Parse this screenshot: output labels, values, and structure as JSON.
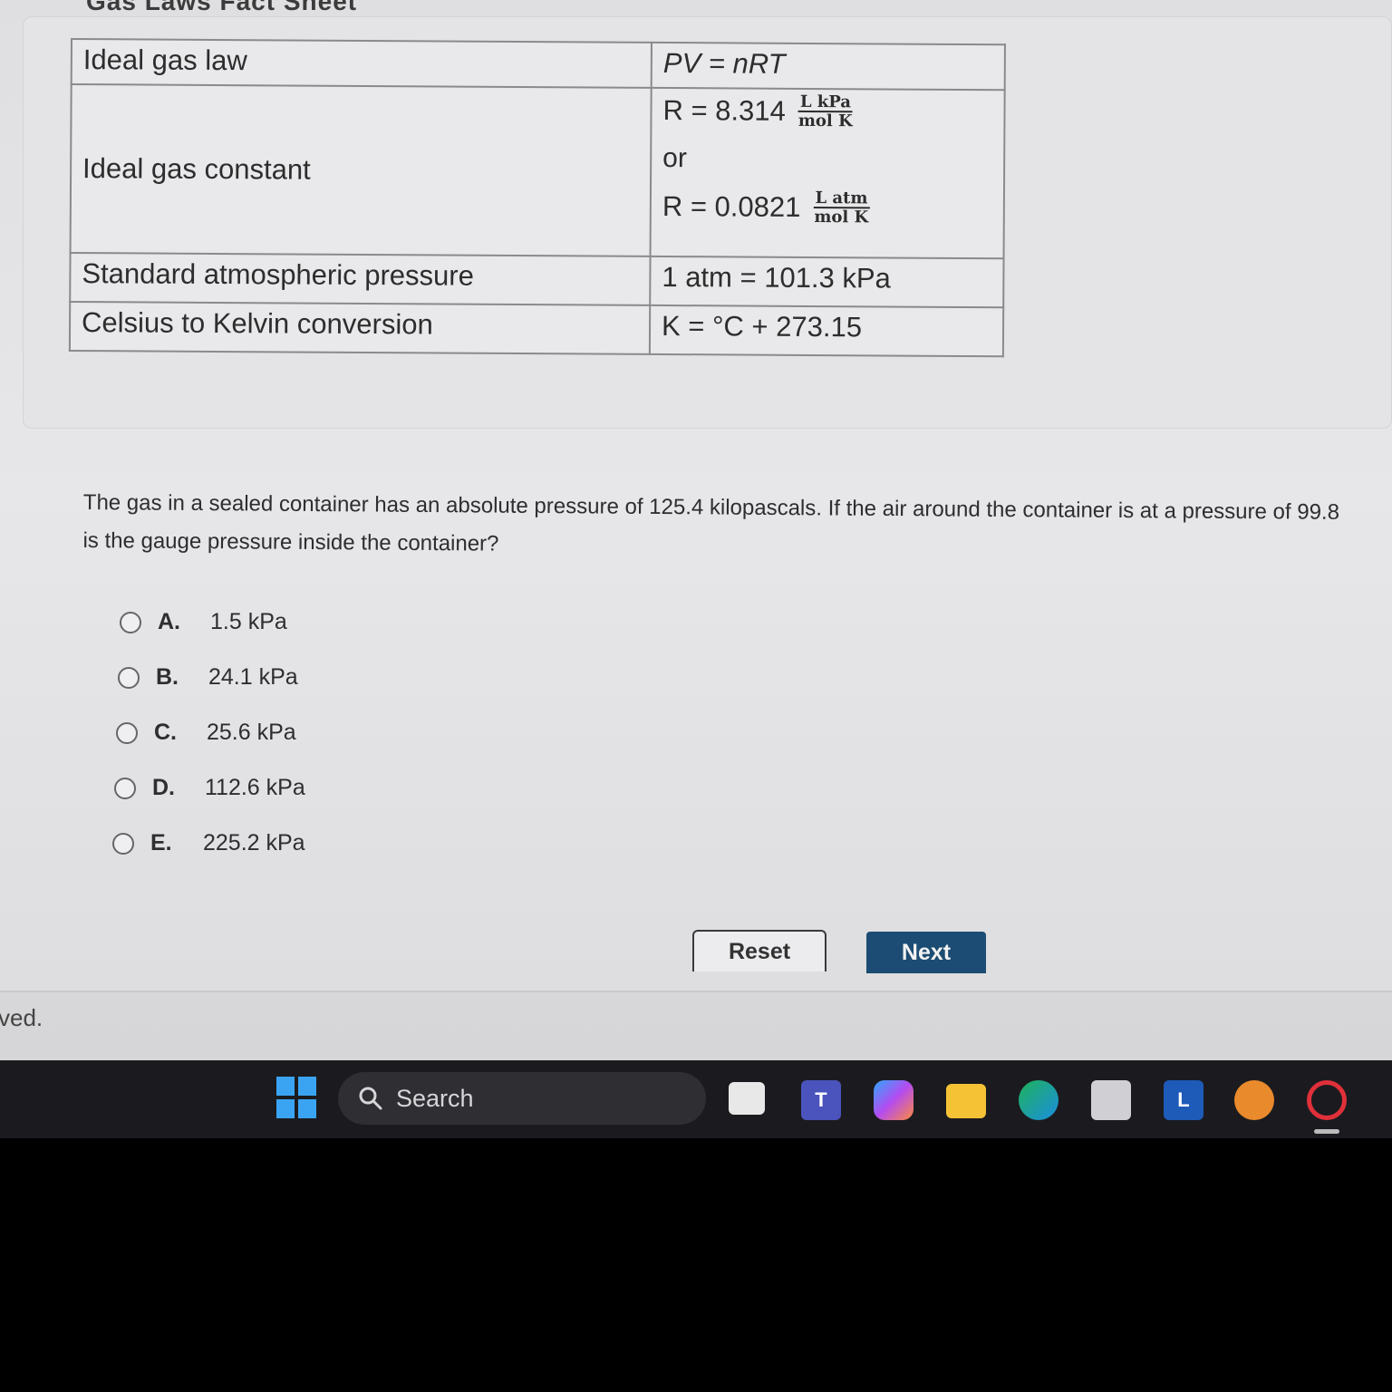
{
  "sheet": {
    "title": "Gas Laws Fact Sheet",
    "rows": [
      {
        "label": "Ideal gas law",
        "value": "PV = nRT"
      },
      {
        "label": "Ideal gas constant",
        "value1": "R = 8.314",
        "unit1_num": "L kPa",
        "unit1_den": "mol K",
        "or": "or",
        "value2": "R = 0.0821",
        "unit2_num": "L atm",
        "unit2_den": "mol K"
      },
      {
        "label": "Standard atmospheric pressure",
        "value": "1 atm = 101.3 kPa"
      },
      {
        "label": "Celsius to Kelvin conversion",
        "value": "K = °C + 273.15"
      }
    ]
  },
  "question": {
    "line1": "The gas in a sealed container has an absolute pressure of 125.4 kilopascals. If the air around the container is at a pressure of 99.8",
    "line2": "is the gauge pressure inside the container?"
  },
  "choices": [
    {
      "letter": "A.",
      "text": "1.5 kPa"
    },
    {
      "letter": "B.",
      "text": "24.1 kPa"
    },
    {
      "letter": "C.",
      "text": "25.6 kPa"
    },
    {
      "letter": "D.",
      "text": "112.6 kPa"
    },
    {
      "letter": "E.",
      "text": "225.2 kPa"
    }
  ],
  "buttons": {
    "reset": "Reset",
    "next": "Next"
  },
  "footer_text": "ved.",
  "taskbar": {
    "search_label": "Search",
    "icons": [
      "windows-start-icon",
      "search-icon",
      "task-view-icon",
      "teams-icon",
      "copilot-icon",
      "file-explorer-icon",
      "edge-icon",
      "store-icon",
      "l-app-icon",
      "emoji-app-icon",
      "opera-icon"
    ],
    "l_app_letter": "L",
    "teams_letter": "T"
  },
  "colors": {
    "next_button": "#1c4c73",
    "taskbar": "#1b1b1f",
    "windows_blue": "#3aa4f3"
  }
}
